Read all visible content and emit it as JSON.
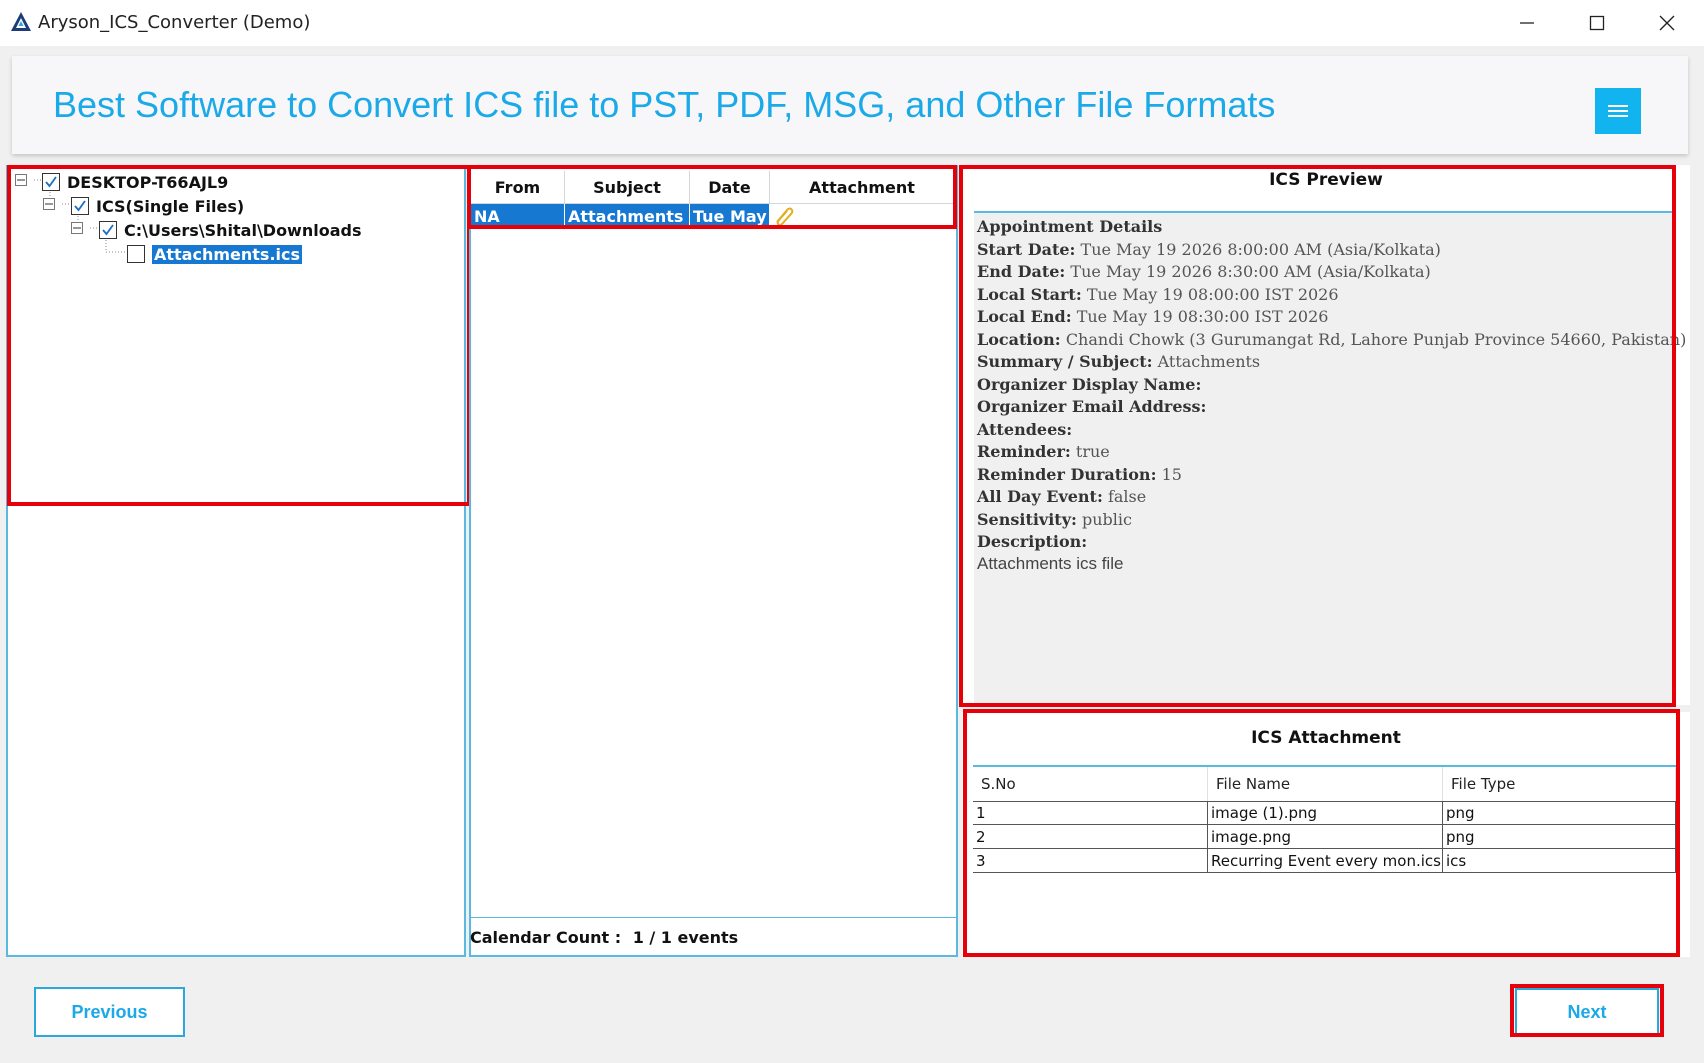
{
  "window": {
    "title": "Aryson_ICS_Converter (Demo)"
  },
  "banner": {
    "headline": "Best Software to Convert ICS file to PST, PDF, MSG, and Other File Formats",
    "menu_icon": "hamburger-menu-icon"
  },
  "tree": {
    "items": [
      {
        "label": "DESKTOP-T66AJL9",
        "checked": true
      },
      {
        "label": "ICS(Single Files)",
        "checked": true
      },
      {
        "label": "C:\\Users\\Shital\\Downloads",
        "checked": true
      },
      {
        "label": "Attachments.ics",
        "checked": false,
        "selected": true
      }
    ]
  },
  "event_grid": {
    "columns": [
      "From",
      "Subject",
      "Date",
      "Attachment"
    ],
    "rows": [
      {
        "from": "NA",
        "subject": "Attachments",
        "date": "Tue May",
        "attachment_icon": "paperclip-icon"
      }
    ],
    "count_label": "Calendar Count :",
    "count_value": "1 / 1 events"
  },
  "preview": {
    "title": "ICS Preview",
    "heading": "Appointment Details",
    "fields": [
      {
        "label": "Start Date:",
        "value": "Tue May 19 2026 8:00:00 AM (Asia/Kolkata)"
      },
      {
        "label": "End Date:",
        "value": "Tue May 19 2026 8:30:00 AM (Asia/Kolkata)"
      },
      {
        "label": "Local Start:",
        "value": "Tue May 19 08:00:00 IST 2026"
      },
      {
        "label": "Local End:",
        "value": "Tue May 19 08:30:00 IST 2026"
      },
      {
        "label": "Location:",
        "value": "Chandi Chowk (3 Gurumangat Rd, Lahore  Punjab Province  54660, Pakistan)"
      },
      {
        "label": "Summary / Subject:",
        "value": "Attachments"
      },
      {
        "label": "Organizer Display Name:",
        "value": ""
      },
      {
        "label": "Organizer Email Address:",
        "value": ""
      },
      {
        "label": "Attendees:",
        "value": ""
      },
      {
        "label": "Reminder:",
        "value": "true"
      },
      {
        "label": "Reminder Duration:",
        "value": "15"
      },
      {
        "label": "All Day Event:",
        "value": "false"
      },
      {
        "label": "Sensitivity:",
        "value": "public"
      },
      {
        "label": "Description:",
        "value": ""
      }
    ],
    "description_text": "Attachments ics file"
  },
  "attachments": {
    "title": "ICS Attachment",
    "columns": [
      "S.No",
      "File Name",
      "File Type"
    ],
    "rows": [
      {
        "sno": "1",
        "name": "image (1).png",
        "type": "png"
      },
      {
        "sno": "2",
        "name": "image.png",
        "type": "png"
      },
      {
        "sno": "3",
        "name": "Recurring Event every mon.ics",
        "type": "ics"
      }
    ]
  },
  "buttons": {
    "previous": "Previous",
    "next": "Next"
  },
  "colors": {
    "accent": "#1ba9e8",
    "highlight_box": "#e5000a",
    "selection": "#1778d2"
  }
}
